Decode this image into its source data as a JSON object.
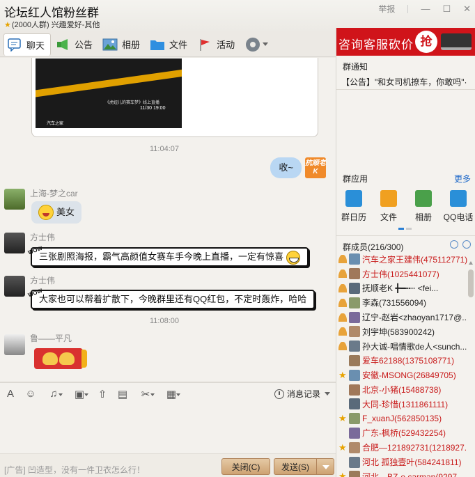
{
  "window": {
    "title": "论坛红人馆粉丝群",
    "subtitle": "(2000人群) 兴趣爱好-其他",
    "report_label": "举报",
    "controls": [
      "minimize-icon",
      "maximize-icon",
      "close-icon"
    ]
  },
  "tabs": [
    {
      "label": "聊天",
      "icon": "chat-icon",
      "active": true
    },
    {
      "label": "公告",
      "icon": "announcement-icon"
    },
    {
      "label": "相册",
      "icon": "album-icon"
    },
    {
      "label": "文件",
      "icon": "folder-icon"
    },
    {
      "label": "活动",
      "icon": "flag-icon"
    }
  ],
  "chat": {
    "poster": {
      "caption": "《虎妞儿的赛车梦》线上直播",
      "time": "11/30 19:00",
      "logo": "汽车之家"
    },
    "messages": [
      {
        "type": "time",
        "text": "11:04:07"
      },
      {
        "type": "self",
        "text": "收~",
        "avatar_text": "抗顺老K"
      },
      {
        "type": "other",
        "sender": "上海-梦之car",
        "text": "美女"
      },
      {
        "type": "other",
        "sender": "方士伟",
        "text": "三张剧照海报，霸气高颜值女赛车手今晚上直播，一定有惊喜"
      },
      {
        "type": "other",
        "sender": "方士伟",
        "text": "大家也可以帮着扩散下，今晚群里还有QQ红包，不定时轰炸，哈哈"
      },
      {
        "type": "time",
        "text": "11:08:00"
      },
      {
        "type": "other",
        "sender": "鲁——平凡",
        "text": ""
      }
    ]
  },
  "toolbar": {
    "icons": [
      "font-icon",
      "emoji-icon",
      "voice-icon",
      "image-icon",
      "upload-icon",
      "gift-icon",
      "scissors-icon",
      "more-icon"
    ],
    "history_label": "消息记录"
  },
  "footer": {
    "ad_text": "[广告] 凹造型，没有一件卫衣怎么行！",
    "close_label": "关闭(C)",
    "send_label": "发送(S)"
  },
  "right_panel": {
    "ad_banner_text": "咨询客服砍价",
    "ad_banner_button": "抢",
    "notice_title": "群通知",
    "notice_text": "【公告】\"和女司机撩车，你敢吗\"·",
    "apps_title": "群应用",
    "apps_more": "更多",
    "apps": [
      {
        "label": "群日历",
        "icon": "calendar-icon",
        "color": "#2a8fd8"
      },
      {
        "label": "文件",
        "icon": "folder-icon",
        "color": "#f0a020"
      },
      {
        "label": "相册",
        "icon": "album-icon",
        "color": "#4aa04a"
      },
      {
        "label": "QQ电话",
        "icon": "phone-icon",
        "color": "#2a8fd8"
      }
    ],
    "members_title": "群成员(216/300)",
    "members": [
      {
        "name": "汽车之家王建伟(475112771)",
        "color": "red",
        "badge": "person"
      },
      {
        "name": "方士伟(1025441077)",
        "color": "red",
        "badge": "person"
      },
      {
        "name": "抚顺老K ╋━┅┄ <fei...",
        "color": "dark",
        "badge": "person"
      },
      {
        "name": "李森(731556094)",
        "color": "dark",
        "badge": "person"
      },
      {
        "name": "辽宁-赵岩<zhaoyan1717@...",
        "color": "dark",
        "badge": "person"
      },
      {
        "name": "刘宇坤(583900242)",
        "color": "dark",
        "badge": "person"
      },
      {
        "name": "孙大诚-唱情歌de人<sunch...",
        "color": "dark",
        "badge": "person"
      },
      {
        "name": "爱车62188(1375108771)",
        "color": "red",
        "badge": "none"
      },
      {
        "name": "安徽-MSONG(26849705)",
        "color": "red",
        "badge": "star"
      },
      {
        "name": "北京-小猪(15488738)",
        "color": "red",
        "badge": "none"
      },
      {
        "name": "大同-珍惜(1311861111)",
        "color": "red",
        "badge": "none"
      },
      {
        "name": "F_xuanJ(562850135)",
        "color": "red",
        "badge": "star"
      },
      {
        "name": "广东-枫桥(529432254)",
        "color": "red",
        "badge": "none"
      },
      {
        "name": "合肥—121892731(1218927...",
        "color": "red",
        "badge": "star"
      },
      {
        "name": "河北 孤独壹叶(584241811)",
        "color": "red",
        "badge": "none"
      },
      {
        "name": "河北—BZ-e carman(9297...",
        "color": "red",
        "badge": "star"
      }
    ]
  }
}
